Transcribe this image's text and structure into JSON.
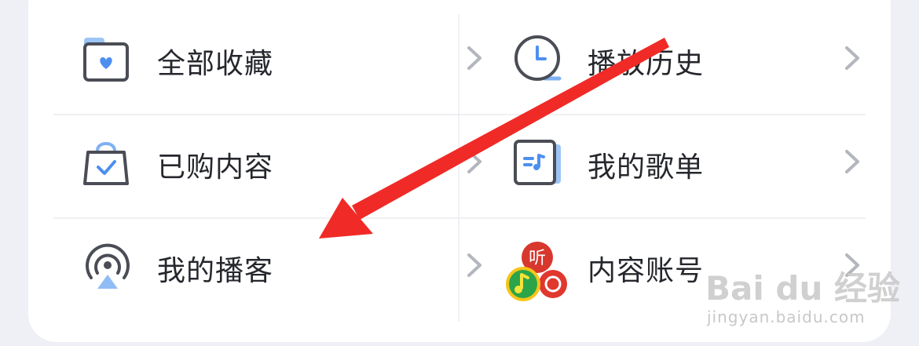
{
  "menu": {
    "left": [
      {
        "label": "全部收藏",
        "icon": "folder-heart-icon"
      },
      {
        "label": "已购内容",
        "icon": "shopping-bag-check-icon"
      },
      {
        "label": "我的播客",
        "icon": "podcast-icon"
      }
    ],
    "right": [
      {
        "label": "播放历史",
        "icon": "clock-icon"
      },
      {
        "label": "我的歌单",
        "icon": "playlist-icon"
      },
      {
        "label": "内容账号",
        "icon": "content-account-apps-icon"
      }
    ]
  },
  "app_badge": {
    "text": "听"
  },
  "watermark": {
    "brand": "Bai du 经验",
    "url": "jingyan.baidu.com"
  },
  "colors": {
    "accent": "#5b9bf0",
    "annotation_arrow": "#f02a26",
    "text": "#25272c"
  }
}
